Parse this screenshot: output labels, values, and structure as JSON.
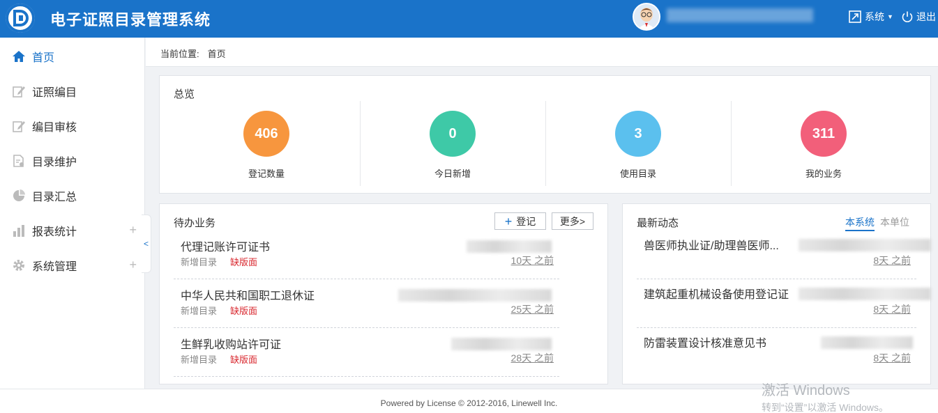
{
  "header": {
    "app_title": "电子证照目录管理系统",
    "system_label": "系统",
    "logout_label": "退出",
    "brand_color": "#1a73c9"
  },
  "sidebar": {
    "items": [
      {
        "label": "首页",
        "icon": "home-icon",
        "active": true
      },
      {
        "label": "证照编目",
        "icon": "edit-icon"
      },
      {
        "label": "编目审核",
        "icon": "edit-icon"
      },
      {
        "label": "目录维护",
        "icon": "document-icon"
      },
      {
        "label": "目录汇总",
        "icon": "pie-icon"
      },
      {
        "label": "报表统计",
        "icon": "bar-chart-icon",
        "expandable": true
      },
      {
        "label": "系统管理",
        "icon": "gear-icon",
        "expandable": true
      }
    ],
    "collapse_glyph": "<"
  },
  "breadcrumb": {
    "label": "当前位置:",
    "current": "首页"
  },
  "overview": {
    "title": "总览",
    "stats": [
      {
        "value": "406",
        "label": "登记数量",
        "color": "#f7963e"
      },
      {
        "value": "0",
        "label": "今日新增",
        "color": "#3ec9a7"
      },
      {
        "value": "3",
        "label": "使用目录",
        "color": "#5bc0ee"
      },
      {
        "value": "311",
        "label": "我的业务",
        "color": "#f25f7a"
      }
    ]
  },
  "todo": {
    "title": "待办业务",
    "register_label": "登记",
    "more_label": "更多>",
    "items": [
      {
        "name": "代理记账许可证书",
        "type": "新增目录",
        "status": "缺版面",
        "time": "10天 之前"
      },
      {
        "name": "中华人民共和国职工退休证",
        "type": "新增目录",
        "status": "缺版面",
        "time": "25天 之前"
      },
      {
        "name": "生鲜乳收购站许可证",
        "type": "新增目录",
        "status": "缺版面",
        "time": "28天 之前"
      }
    ]
  },
  "news": {
    "title": "最新动态",
    "tabs": [
      "本系统",
      "本单位"
    ],
    "items": [
      {
        "name": "兽医师执业证/助理兽医师...",
        "time": "8天 之前"
      },
      {
        "name": "建筑起重机械设备使用登记证",
        "time": "8天 之前"
      },
      {
        "name": "防雷装置设计核准意见书",
        "time": "8天 之前"
      }
    ]
  },
  "footer": {
    "text": "Powered by License © 2012-2016, Linewell Inc."
  },
  "watermark": {
    "line1": "激活 Windows",
    "line2": "转到“设置”以激活 Windows。"
  }
}
